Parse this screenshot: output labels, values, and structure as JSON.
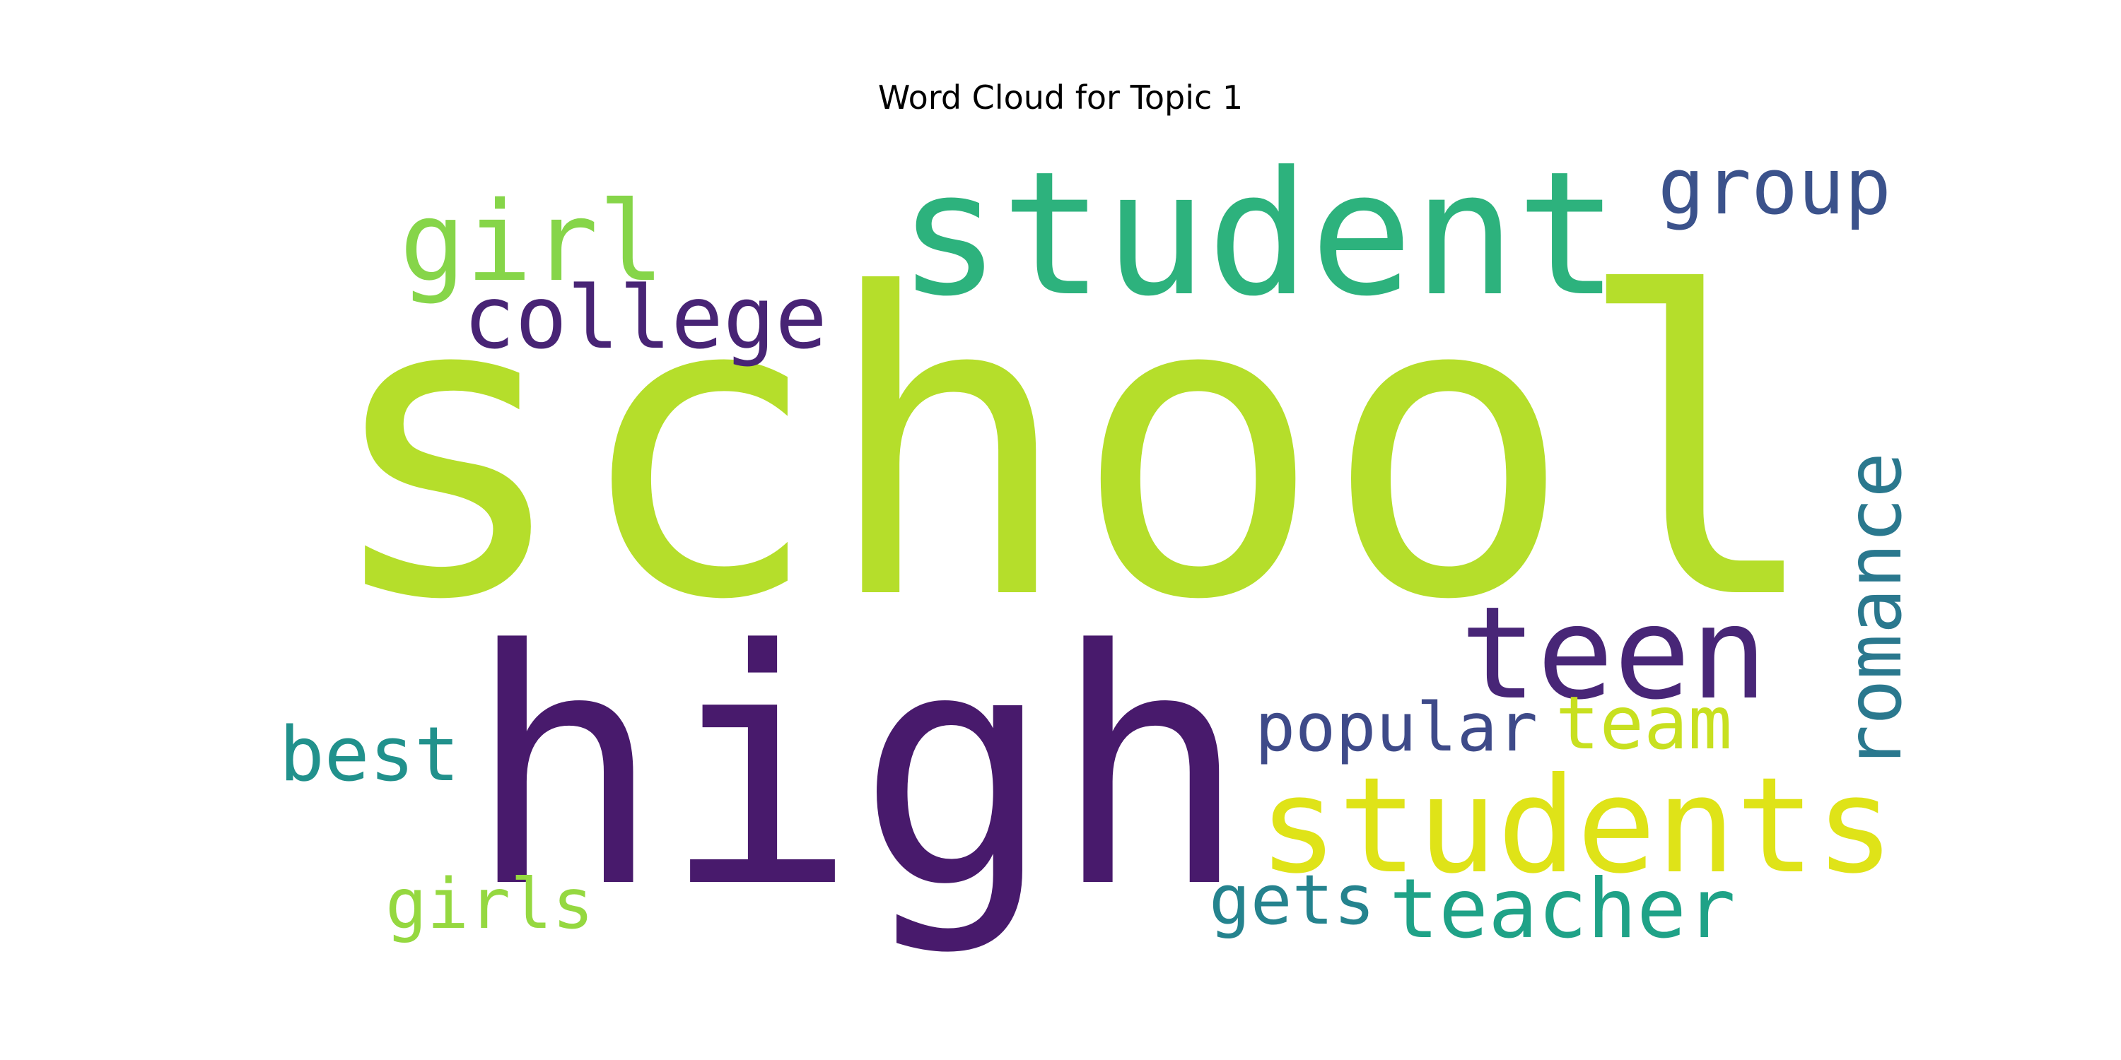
{
  "title": "Word Cloud for Topic 1",
  "words": [
    {
      "text": "school",
      "color": "#b5de2b"
    },
    {
      "text": "high",
      "color": "#481a6c"
    },
    {
      "text": "student",
      "color": "#2db27d"
    },
    {
      "text": "students",
      "color": "#dfe318"
    },
    {
      "text": "teen",
      "color": "#482677"
    },
    {
      "text": "girl",
      "color": "#86d549"
    },
    {
      "text": "college",
      "color": "#482475"
    },
    {
      "text": "group",
      "color": "#3b528b"
    },
    {
      "text": "romance",
      "color": "#2a788e"
    },
    {
      "text": "popular",
      "color": "#3e4a89"
    },
    {
      "text": "team",
      "color": "#c8e020"
    },
    {
      "text": "best",
      "color": "#21918c"
    },
    {
      "text": "teacher",
      "color": "#1fa287"
    },
    {
      "text": "gets",
      "color": "#25838e"
    },
    {
      "text": "girls",
      "color": "#95d840"
    }
  ]
}
